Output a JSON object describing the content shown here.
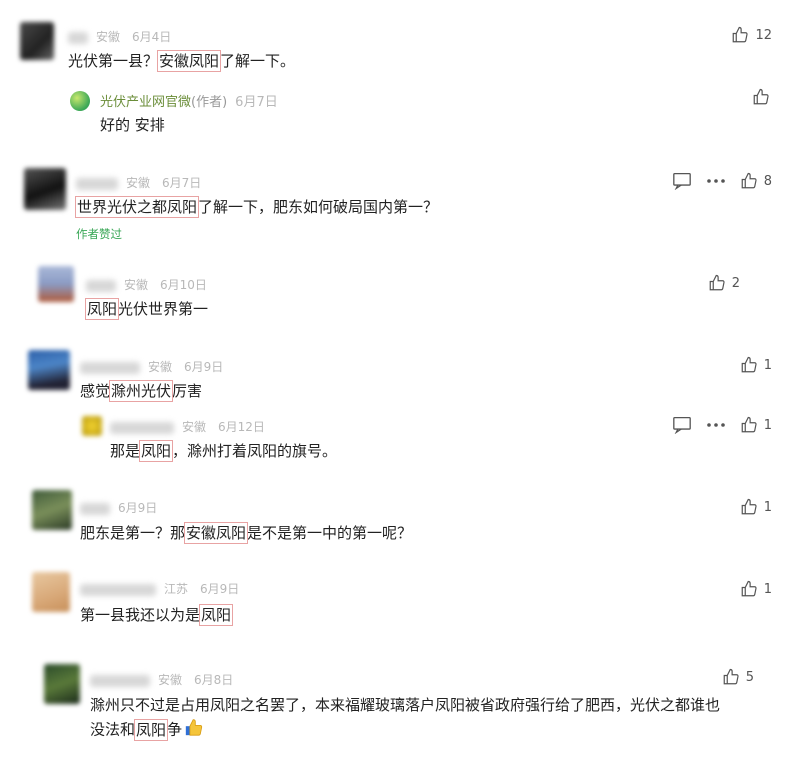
{
  "comments": [
    {
      "location": "安徽",
      "date": "6月4日",
      "text_before": "光伏第一县？",
      "text_highlight": "安徽凤阳",
      "text_after": "了解一下。",
      "like_count": "12",
      "reply": {
        "author": "光伏产业网官微",
        "author_tag": "(作者)",
        "date": "6月7日",
        "text": "好的  安排"
      }
    },
    {
      "location": "安徽",
      "date": "6月7日",
      "text_highlight": "世界光伏之都凤阳",
      "text_after": "了解一下，肥东如何破局国内第一？",
      "author_liked": "作者赞过",
      "like_count": "8"
    },
    {
      "location": "安徽",
      "date": "6月10日",
      "text_highlight": "凤阳",
      "text_after": "光伏世界第一",
      "like_count": "2"
    },
    {
      "location": "安徽",
      "date": "6月9日",
      "text_before": "感觉",
      "text_highlight": "滁州光伏",
      "text_after": "厉害",
      "like_count": "1",
      "reply": {
        "location": "安徽",
        "date": "6月12日",
        "text_before": "那是",
        "text_highlight": "凤阳",
        "text_after": "，滁州打着凤阳的旗号。",
        "like_count": "1"
      }
    },
    {
      "date": "6月9日",
      "text_before": "肥东是第一？那",
      "text_highlight": "安徽凤阳",
      "text_after": "是不是第一中的第一呢？",
      "like_count": "1"
    },
    {
      "location": "江苏",
      "date": "6月9日",
      "text_before": "第一县我还以为是",
      "text_highlight": "凤阳",
      "like_count": "1"
    },
    {
      "location": "安徽",
      "date": "6月8日",
      "text_line1": "滁州只不过是占用凤阳之名罢了，本来福耀玻璃落户凤阳被省政府强行给了肥西，光伏之都谁也",
      "text_line2_before": "没法和",
      "text_line2_highlight": "凤阳",
      "text_line2_after": "争",
      "like_count": "5"
    }
  ],
  "colors": {
    "highlight_border": "#e8a3a3",
    "author_liked": "#3aa757",
    "meta": "#b8b8b8"
  },
  "icons": [
    "thumbs-up-icon",
    "comment-icon",
    "more-icon",
    "thumbs-up-emoji"
  ]
}
